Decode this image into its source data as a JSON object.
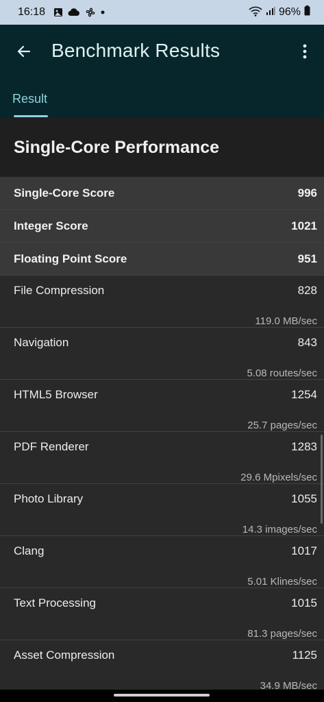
{
  "status_bar": {
    "time": "16:18",
    "battery": "96%",
    "icons": [
      "gallery-icon",
      "cloud-icon",
      "fan-icon",
      "dot-icon",
      "wifi-icon",
      "signal-icon",
      "battery-icon"
    ]
  },
  "app_bar": {
    "title": "Benchmark Results",
    "tab_label": "Result",
    "accent_color": "#8fd3e0"
  },
  "section": {
    "title": "Single-Core Performance"
  },
  "summary_rows": [
    {
      "name": "Single-Core Score",
      "score": "996"
    },
    {
      "name": "Integer Score",
      "score": "1021"
    },
    {
      "name": "Floating Point Score",
      "score": "951"
    }
  ],
  "detail_rows": [
    {
      "name": "File Compression",
      "score": "828",
      "rate": "119.0 MB/sec"
    },
    {
      "name": "Navigation",
      "score": "843",
      "rate": "5.08 routes/sec"
    },
    {
      "name": "HTML5 Browser",
      "score": "1254",
      "rate": "25.7 pages/sec"
    },
    {
      "name": "PDF Renderer",
      "score": "1283",
      "rate": "29.6 Mpixels/sec"
    },
    {
      "name": "Photo Library",
      "score": "1055",
      "rate": "14.3 images/sec"
    },
    {
      "name": "Clang",
      "score": "1017",
      "rate": "5.01 Klines/sec"
    },
    {
      "name": "Text Processing",
      "score": "1015",
      "rate": "81.3 pages/sec"
    },
    {
      "name": "Asset Compression",
      "score": "1125",
      "rate": "34.9 MB/sec"
    }
  ]
}
